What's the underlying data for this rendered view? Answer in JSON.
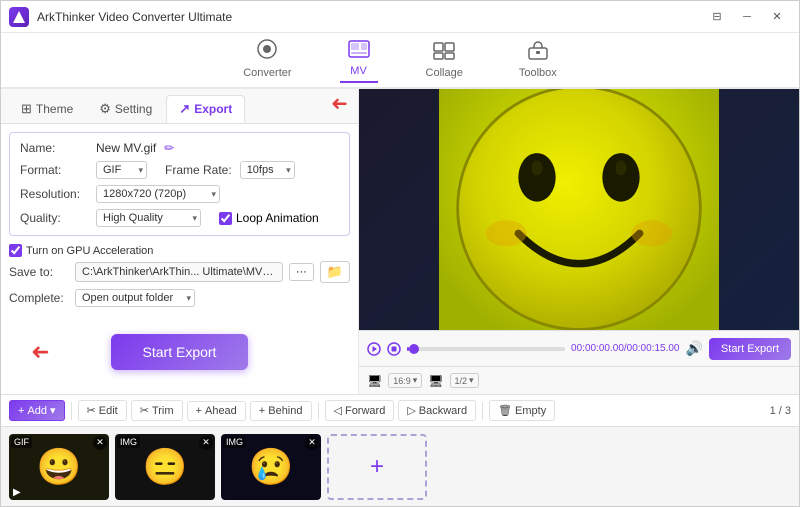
{
  "app": {
    "title": "ArkThinker Video Converter Ultimate",
    "logo_text": "A"
  },
  "title_bar": {
    "title": "ArkThinker Video Converter Ultimate",
    "controls": [
      "⊟",
      "─",
      "✕"
    ]
  },
  "top_nav": {
    "items": [
      {
        "id": "converter",
        "label": "Converter",
        "icon": "⊙",
        "active": false
      },
      {
        "id": "mv",
        "label": "MV",
        "icon": "🖼",
        "active": true
      },
      {
        "id": "collage",
        "label": "Collage",
        "icon": "⊞",
        "active": false
      },
      {
        "id": "toolbox",
        "label": "Toolbox",
        "icon": "🧰",
        "active": false
      }
    ]
  },
  "tabs": [
    {
      "id": "theme",
      "label": "Theme",
      "icon": "⊞",
      "active": false
    },
    {
      "id": "setting",
      "label": "Setting",
      "icon": "⚙",
      "active": false
    },
    {
      "id": "export",
      "label": "Export",
      "icon": "↗",
      "active": true
    }
  ],
  "export_settings": {
    "name_label": "Name:",
    "name_value": "New MV.gif",
    "format_label": "Format:",
    "format_value": "GIF",
    "frame_rate_label": "Frame Rate:",
    "frame_rate_value": "10fps",
    "resolution_label": "Resolution:",
    "resolution_value": "1280x720 (720p)",
    "quality_label": "Quality:",
    "quality_value": "High Quality",
    "loop_label": "Loop Animation",
    "gpu_label": "Turn on GPU Acceleration",
    "save_to_label": "Save to:",
    "save_path": "C:\\ArkThinker\\ArkThin... Ultimate\\MV Exported",
    "complete_label": "Complete:",
    "complete_value": "Open output folder"
  },
  "start_export_label": "Start Export",
  "playback": {
    "time_current": "00:00:00.00",
    "time_total": "00:00:15.00",
    "progress": 1,
    "aspect_ratio": "16:9",
    "zoom": "1/2"
  },
  "toolbar": {
    "add_label": "Add",
    "edit_label": "Edit",
    "trim_label": "Trim",
    "ahead_label": "Ahead",
    "behind_label": "Behind",
    "forward_label": "Forward",
    "backward_label": "Backward",
    "empty_label": "Empty",
    "page_count": "1 / 3"
  },
  "thumbnails": [
    {
      "id": 1,
      "emoji": "😀",
      "bg": "#d4d400",
      "type": "gif"
    },
    {
      "id": 2,
      "emoji": "😑",
      "bg": "#111",
      "type": "img"
    },
    {
      "id": 3,
      "emoji": "😢",
      "bg": "#1a1a3a",
      "type": "img"
    }
  ]
}
